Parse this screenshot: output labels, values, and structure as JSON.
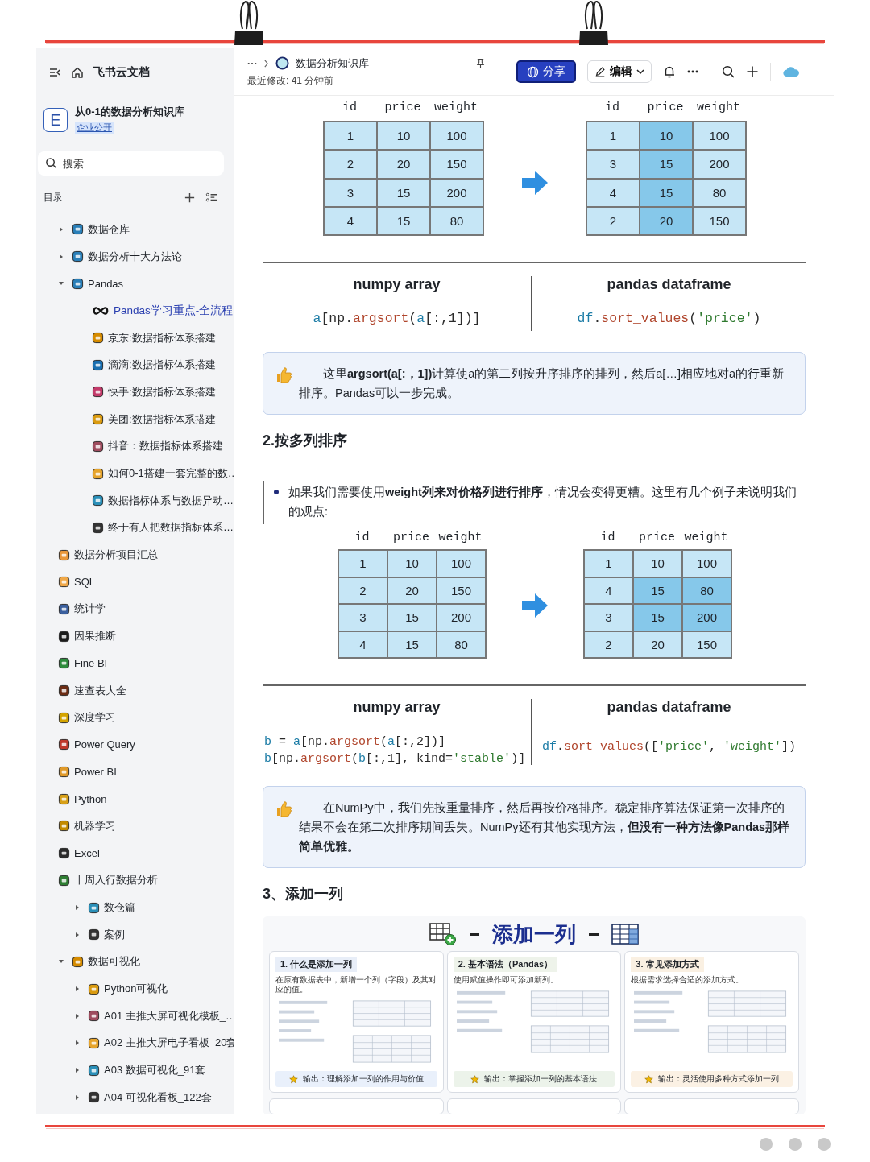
{
  "sidebar": {
    "app_title": "飞书云文档",
    "space": {
      "logo": "E",
      "name": "从0-1的数据分析知识库",
      "badge": "企业公开"
    },
    "search": {
      "placeholder": "搜索"
    },
    "toc_label": "目录",
    "items": [
      {
        "label": "数据仓库",
        "expanded": false,
        "selected": false
      },
      {
        "label": "数据分析十大方法论",
        "expanded": false,
        "selected": false
      },
      {
        "label": "Pandas",
        "expanded": true,
        "selected": false,
        "children": [
          {
            "label": "Pandas学习重点-全流程",
            "selected": true
          },
          {
            "label": "京东:数据指标体系搭建",
            "selected": false
          },
          {
            "label": "滴滴:数据指标体系搭建",
            "selected": false
          },
          {
            "label": "快手:数据指标体系搭建",
            "selected": false
          },
          {
            "label": "美团:数据指标体系搭建",
            "selected": false
          },
          {
            "label": "抖音：数据指标体系搭建",
            "selected": false
          },
          {
            "label": "如何0-1搭建一套完整的数…",
            "selected": false
          },
          {
            "label": "数据指标体系与数据异动…",
            "selected": false
          },
          {
            "label": "终于有人把数据指标体系…",
            "selected": false
          }
        ]
      },
      {
        "label": "数据分析项目汇总",
        "selected": false
      },
      {
        "label": "SQL",
        "selected": false
      },
      {
        "label": "统计学",
        "selected": false
      },
      {
        "label": "因果推断",
        "selected": false
      },
      {
        "label": "Fine BI",
        "selected": false
      },
      {
        "label": "速查表大全",
        "selected": false
      },
      {
        "label": "深度学习",
        "selected": false
      },
      {
        "label": "Power Query",
        "selected": false
      },
      {
        "label": "Power BI",
        "selected": false
      },
      {
        "label": "Python",
        "selected": false
      },
      {
        "label": "机器学习",
        "selected": false
      },
      {
        "label": "Excel",
        "selected": false
      },
      {
        "label": "十周入行数据分析",
        "selected": false,
        "children": [
          {
            "label": "数仓篇",
            "expanded": false,
            "selected": false
          },
          {
            "label": "案例",
            "expanded": false,
            "selected": false
          }
        ]
      },
      {
        "label": "数据可视化",
        "expanded": true,
        "selected": false,
        "children": [
          {
            "label": "Python可视化",
            "expanded": false,
            "selected": false
          },
          {
            "label": "A01 主推大屏可视化模板_…",
            "expanded": false,
            "selected": false
          },
          {
            "label": "A02 主推大屏电子看板_20套",
            "expanded": false,
            "selected": false
          },
          {
            "label": "A03 数据可视化_91套",
            "expanded": false,
            "selected": false
          },
          {
            "label": "A04 可视化看板_122套",
            "expanded": false,
            "selected": false
          }
        ]
      }
    ]
  },
  "header": {
    "title": "数据分析知识库",
    "modified": "最近修改: 41 分钟前",
    "share": "分享",
    "edit": "编辑"
  },
  "blocks": [
    {
      "kind": "table-pair",
      "left_columns": [
        "id",
        "price",
        "weight"
      ],
      "right_columns": [
        "id",
        "price",
        "weight"
      ],
      "left": [
        {
          "cells": [
            "1",
            "10",
            "100"
          ],
          "highlighted": [
            false,
            false,
            false
          ]
        },
        {
          "cells": [
            "2",
            "20",
            "150"
          ],
          "highlighted": [
            false,
            false,
            false
          ]
        },
        {
          "cells": [
            "3",
            "15",
            "200"
          ],
          "highlighted": [
            false,
            false,
            false
          ]
        },
        {
          "cells": [
            "4",
            "15",
            "80"
          ],
          "highlighted": [
            false,
            false,
            false
          ]
        }
      ],
      "right": [
        {
          "cells": [
            "1",
            "10",
            "100"
          ],
          "highlighted": [
            false,
            true,
            false
          ]
        },
        {
          "cells": [
            "3",
            "15",
            "200"
          ],
          "highlighted": [
            false,
            true,
            false
          ]
        },
        {
          "cells": [
            "4",
            "15",
            "80"
          ],
          "highlighted": [
            false,
            true,
            false
          ]
        },
        {
          "cells": [
            "2",
            "20",
            "150"
          ],
          "highlighted": [
            false,
            true,
            false
          ]
        }
      ]
    },
    {
      "kind": "code-compare",
      "left_title": "numpy array",
      "right_title": "pandas dataframe",
      "left_code": [
        [
          {
            "t": "a",
            "kind": "var"
          },
          {
            "t": "[np.",
            "kind": "plain"
          },
          {
            "t": "argsort",
            "kind": "fn"
          },
          {
            "t": "(",
            "kind": "plain"
          },
          {
            "t": "a",
            "kind": "var"
          },
          {
            "t": "[:,1])]",
            "kind": "plain"
          }
        ]
      ],
      "right_code": [
        [
          {
            "t": "df",
            "kind": "var"
          },
          {
            "t": ".",
            "kind": "plain"
          },
          {
            "t": "sort_values",
            "kind": "fn"
          },
          {
            "t": "(",
            "kind": "plain"
          },
          {
            "t": "'price'",
            "kind": "str"
          },
          {
            "t": ")",
            "kind": "plain"
          }
        ]
      ]
    },
    {
      "kind": "callout",
      "text": "这里**argsort(a[:，1])**计算使a的第二列按升序排序的排列，然后a[…]相应地对a的行重新排序。Pandas可以一步完成。"
    },
    {
      "kind": "heading",
      "text": "2.按多列排序"
    },
    {
      "kind": "bullet-quote",
      "text": "如果我们需要使用**weight列来对价格列进行排序**，情况会变得更糟。这里有几个例子来说明我们的观点:"
    },
    {
      "kind": "table-pair",
      "left_columns": [
        "id",
        "price",
        "weight"
      ],
      "right_columns": [
        "id",
        "price",
        "weight"
      ],
      "left": [
        {
          "cells": [
            "1",
            "10",
            "100"
          ],
          "highlighted": [
            false,
            false,
            false
          ]
        },
        {
          "cells": [
            "2",
            "20",
            "150"
          ],
          "highlighted": [
            false,
            false,
            false
          ]
        },
        {
          "cells": [
            "3",
            "15",
            "200"
          ],
          "highlighted": [
            false,
            false,
            false
          ]
        },
        {
          "cells": [
            "4",
            "15",
            "80"
          ],
          "highlighted": [
            false,
            false,
            false
          ]
        }
      ],
      "right": [
        {
          "cells": [
            "1",
            "10",
            "100"
          ],
          "highlighted": [
            false,
            false,
            false
          ]
        },
        {
          "cells": [
            "4",
            "15",
            "80"
          ],
          "highlighted": [
            false,
            true,
            true
          ]
        },
        {
          "cells": [
            "3",
            "15",
            "200"
          ],
          "highlighted": [
            false,
            true,
            true
          ]
        },
        {
          "cells": [
            "2",
            "20",
            "150"
          ],
          "highlighted": [
            false,
            false,
            false
          ]
        }
      ]
    },
    {
      "kind": "code-compare",
      "left_title": "numpy array",
      "right_title": "pandas dataframe",
      "left_code": [
        [
          {
            "t": "b",
            "kind": "var"
          },
          {
            "t": " = ",
            "kind": "plain"
          },
          {
            "t": "a",
            "kind": "var"
          },
          {
            "t": "[np.",
            "kind": "plain"
          },
          {
            "t": "argsort",
            "kind": "fn"
          },
          {
            "t": "(",
            "kind": "plain"
          },
          {
            "t": "a",
            "kind": "var"
          },
          {
            "t": "[:,2])]",
            "kind": "plain"
          }
        ],
        [
          {
            "t": "b",
            "kind": "var"
          },
          {
            "t": "[np.",
            "kind": "plain"
          },
          {
            "t": "argsort",
            "kind": "fn"
          },
          {
            "t": "(",
            "kind": "plain"
          },
          {
            "t": "b",
            "kind": "var"
          },
          {
            "t": "[:,1], kind=",
            "kind": "plain"
          },
          {
            "t": "'stable'",
            "kind": "str"
          },
          {
            "t": ")]",
            "kind": "plain"
          }
        ]
      ],
      "right_code": [
        [
          {
            "t": "df",
            "kind": "var"
          },
          {
            "t": ".",
            "kind": "plain"
          },
          {
            "t": "sort_values",
            "kind": "fn"
          },
          {
            "t": "([",
            "kind": "plain"
          },
          {
            "t": "'price'",
            "kind": "str"
          },
          {
            "t": ", ",
            "kind": "plain"
          },
          {
            "t": "'weight'",
            "kind": "str"
          },
          {
            "t": "])",
            "kind": "plain"
          }
        ]
      ]
    },
    {
      "kind": "callout",
      "text": "在NumPy中，我们先按重量排序，然后再按价格排序。稳定排序算法保证第一次排序的结果不会在第二次排序期间丢失。NumPy还有其他实现方法，**但没有一种方法像Pandas那样简单优雅。**"
    },
    {
      "kind": "heading",
      "text": "3、添加一列"
    },
    {
      "kind": "infographic",
      "title": "添加一列",
      "cards": [
        {
          "heading": "1. 什么是添加一列",
          "desc": "在原有数据表中，新增一个列（字段）及其对应的值。",
          "footer": "输出：理解添加一列的作用与价值"
        },
        {
          "heading": "2. 基本语法（Pandas）",
          "desc": "使用赋值操作即可添加新列。",
          "footer": "输出：掌握添加一列的基本语法"
        },
        {
          "heading": "3. 常见添加方式",
          "desc": "根据需求选择合适的添加方式。",
          "footer": "输出：灵活使用多种方式添加一列"
        }
      ]
    }
  ]
}
